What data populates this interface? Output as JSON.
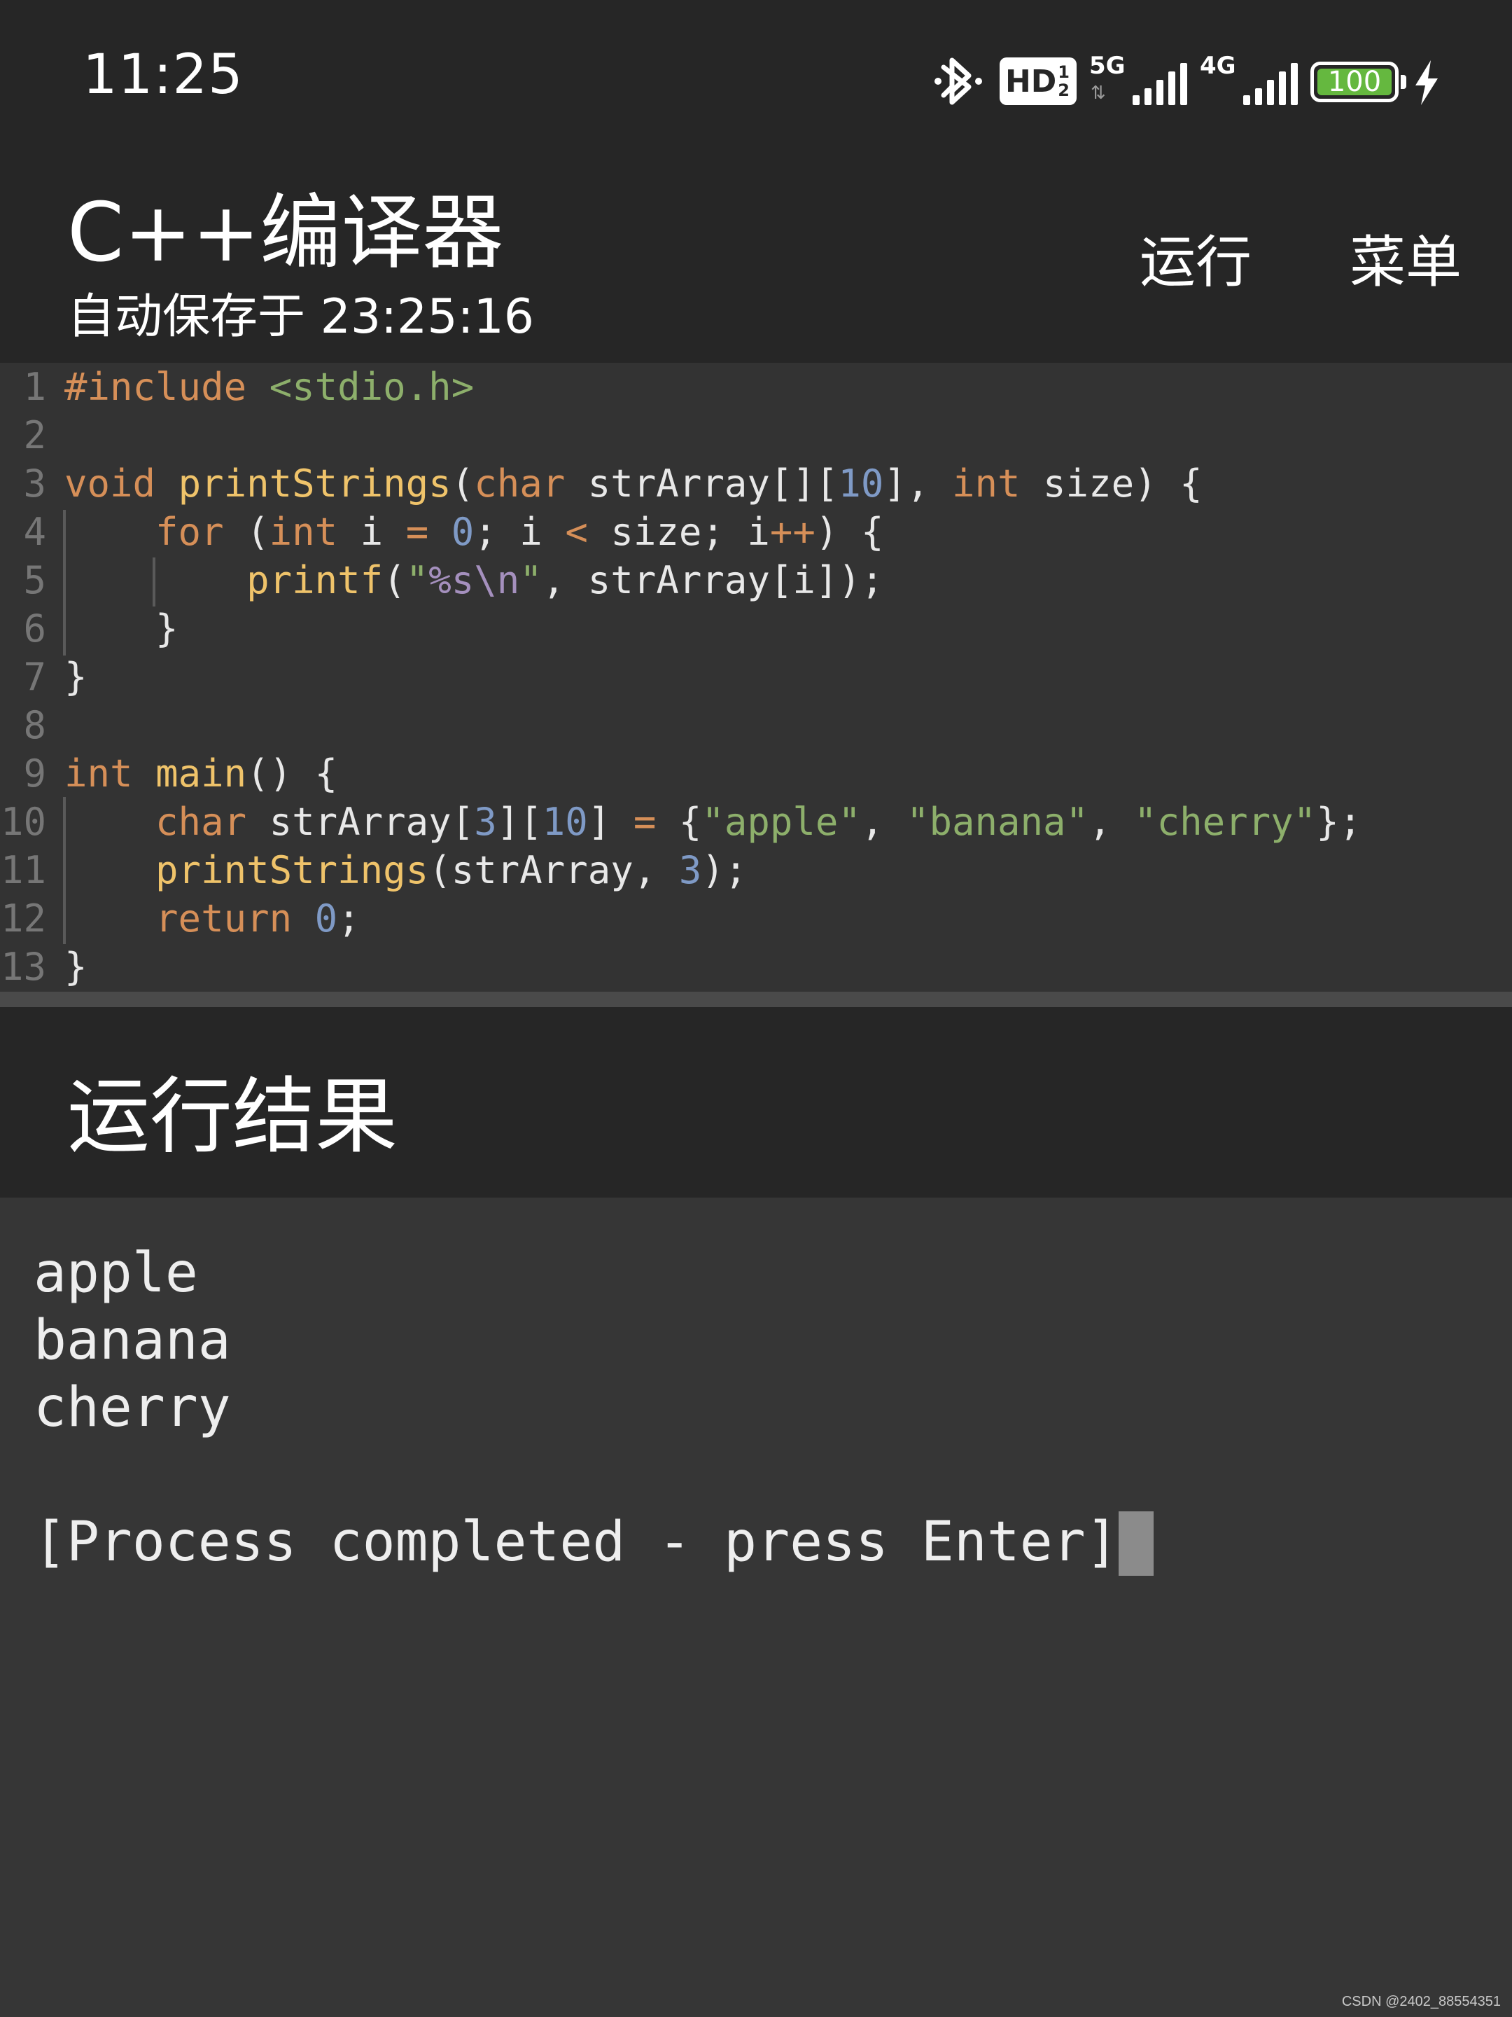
{
  "status_bar": {
    "time": "11:25",
    "icons": [
      "bluetooth-icon",
      "hd-voice-icon",
      "signal-5g-icon",
      "signal-4g-icon",
      "battery-icon",
      "charging-bolt-icon"
    ],
    "hd_label": "HD",
    "hd_fraction_top": "1",
    "hd_fraction_bottom": "2",
    "network_1": "5G",
    "network_2": "4G",
    "battery_level": "100",
    "battery_color": "#65b83f"
  },
  "app_bar": {
    "title": "C++编译器",
    "subtitle": "自动保存于 23:25:16",
    "run_label": "运行",
    "menu_label": "菜单"
  },
  "editor": {
    "line_numbers": [
      "1",
      "2",
      "3",
      "4",
      "5",
      "6",
      "7",
      "8",
      "9",
      "10",
      "11",
      "12",
      "13"
    ],
    "line_1": [
      "#include",
      " ",
      "<stdio.h>"
    ],
    "line_3": [
      "void",
      " ",
      "printStrings",
      "(",
      "char",
      " strArray[][",
      "10",
      "], ",
      "int",
      " size) {"
    ],
    "line_4": [
      "    ",
      "for",
      " (",
      "int",
      " i ",
      "=",
      " ",
      "0",
      "; i ",
      "<",
      " size; i",
      "++",
      ") {"
    ],
    "line_5": [
      "        ",
      "printf",
      "(",
      "\"",
      "%s\\n",
      "\"",
      ", strArray[i]);"
    ],
    "line_6": [
      "    }"
    ],
    "line_7": [
      "}"
    ],
    "line_9": [
      "int",
      " ",
      "main",
      "() {"
    ],
    "line_10": [
      "    ",
      "char",
      " strArray[",
      "3",
      "][",
      "10",
      "] ",
      "=",
      " {",
      "\"apple\"",
      ", ",
      "\"banana\"",
      ", ",
      "\"cherry\"",
      "};"
    ],
    "line_11": [
      "    ",
      "printStrings",
      "(strArray, ",
      "3",
      ");"
    ],
    "line_12": [
      "    ",
      "return",
      " ",
      "0",
      ";"
    ],
    "line_13": [
      "}"
    ],
    "colors": {
      "keyword": "#d68f58",
      "function": "#efc36a",
      "string": "#8daf6b",
      "number": "#7f9ac6",
      "escape": "#a590be",
      "plain": "#e8e8e8",
      "gutter": "#767676",
      "background": "#333333"
    }
  },
  "result": {
    "title": "运行结果",
    "output_lines": [
      "apple",
      "banana",
      "cherry",
      "",
      "[Process completed - press Enter]"
    ]
  },
  "watermark": "CSDN @2402_88554351"
}
